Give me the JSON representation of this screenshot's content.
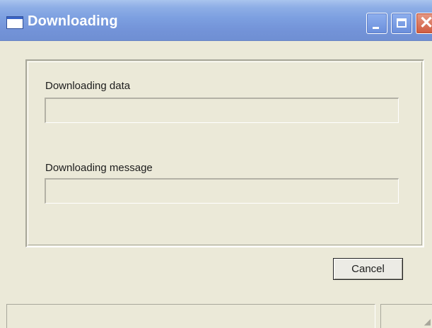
{
  "window": {
    "title": "Downloading",
    "icon": "window-icon",
    "controls": [
      "minimize-icon",
      "maximize-icon",
      "close-icon"
    ]
  },
  "fields": [
    {
      "label": "Downloading data",
      "progress": 0
    },
    {
      "label": "Downloading message",
      "progress": 0
    }
  ],
  "buttons": {
    "cancel_label": "Cancel"
  },
  "statusbar": {
    "pane_1_text": "",
    "pane_2_text": ""
  },
  "colors": {
    "titlebar": "#7c9fe0",
    "window_bg": "#ebe9d8",
    "close_button": "#cf5b3f"
  }
}
